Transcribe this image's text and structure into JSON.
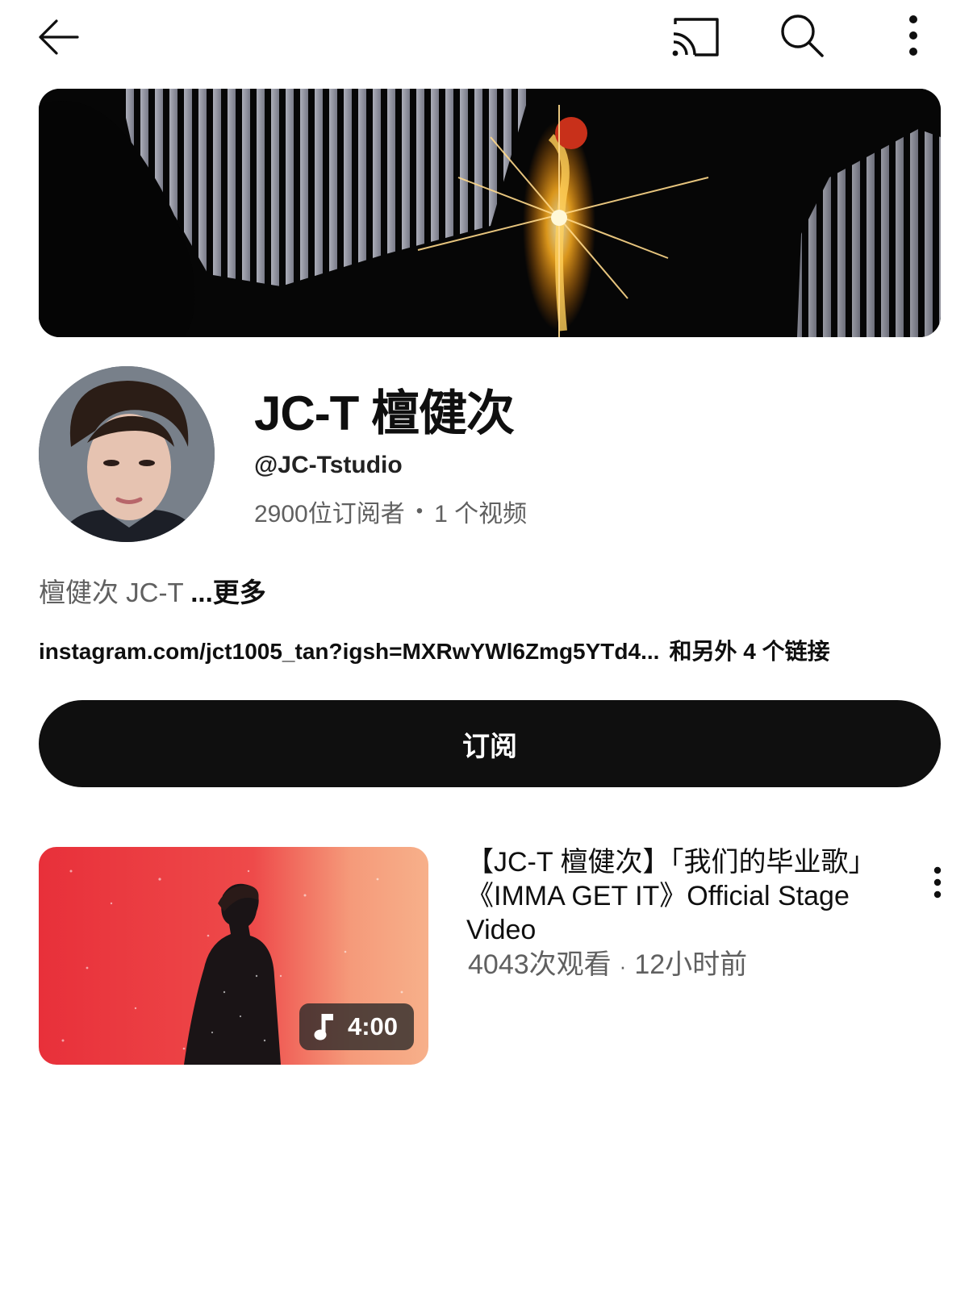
{
  "topbar": {
    "back_icon": "arrow-left-icon",
    "cast_icon": "cast-icon",
    "search_icon": "search-icon",
    "more_icon": "more-vertical-icon"
  },
  "channel": {
    "name": "JC-T 檀健次",
    "handle": "@JC-Tstudio",
    "subscribers": "2900位订阅者",
    "separator": "•",
    "videos": "1 个视频",
    "description": "檀健次 JC-T ",
    "more_label": "...更多",
    "link": "instagram.com/jct1005_tan?igsh=MXRwYWl6Zmg5YTd4...",
    "other_links": "和另外 4 个链接"
  },
  "subscribe_label": "订阅",
  "video": {
    "title": "【JC-T 檀健次】「我们的毕业歌」《IMMA GET IT》Official Stage Video",
    "views": "4043次观看",
    "separator": "·",
    "age": "12小时前",
    "duration": "4:00",
    "duration_icon": "music-note-icon"
  },
  "colors": {
    "text_primary": "#0f0f0f",
    "text_secondary": "#606060",
    "button_bg": "#0f0f0f",
    "thumbnail_red": "#e8303a"
  }
}
